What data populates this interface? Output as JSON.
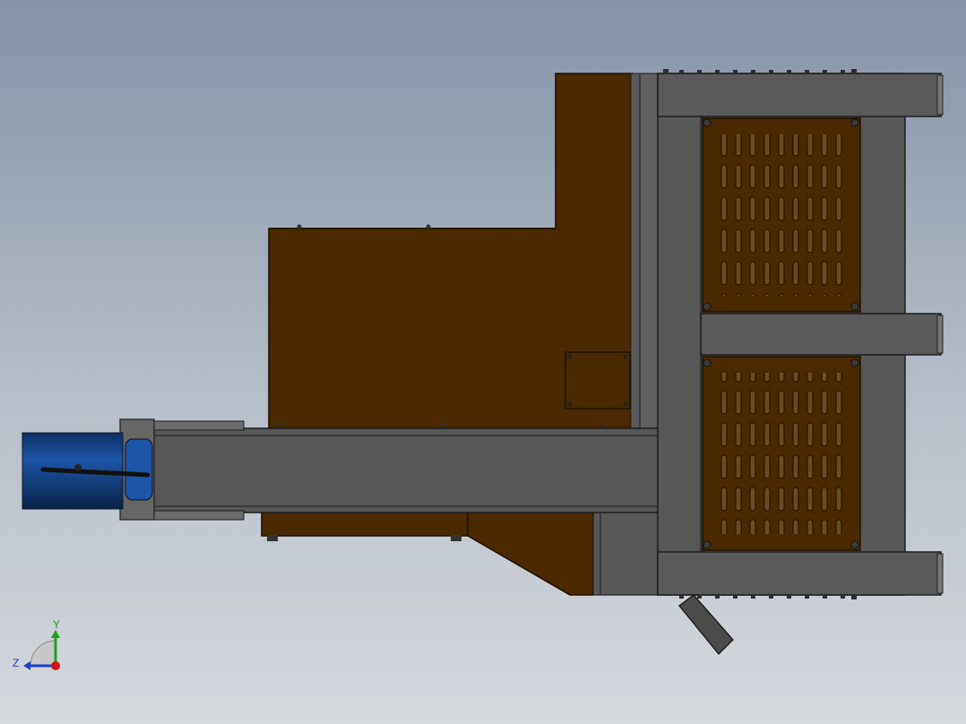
{
  "colors": {
    "background_top": "#8593a8",
    "background_bottom": "#d6d9de",
    "frame_steel": "#555555",
    "frame_edge": "#2b2b2b",
    "sheet_metal_brown": "#4a2800",
    "vent_slot": "#6b4a22",
    "motor_blue": "#0e3a78",
    "axis_y": "#1aa31a",
    "axis_z": "#1f3fcc",
    "axis_x": "#d41010"
  },
  "axis_triad": {
    "y_label": "Y",
    "z_label": "Z"
  }
}
